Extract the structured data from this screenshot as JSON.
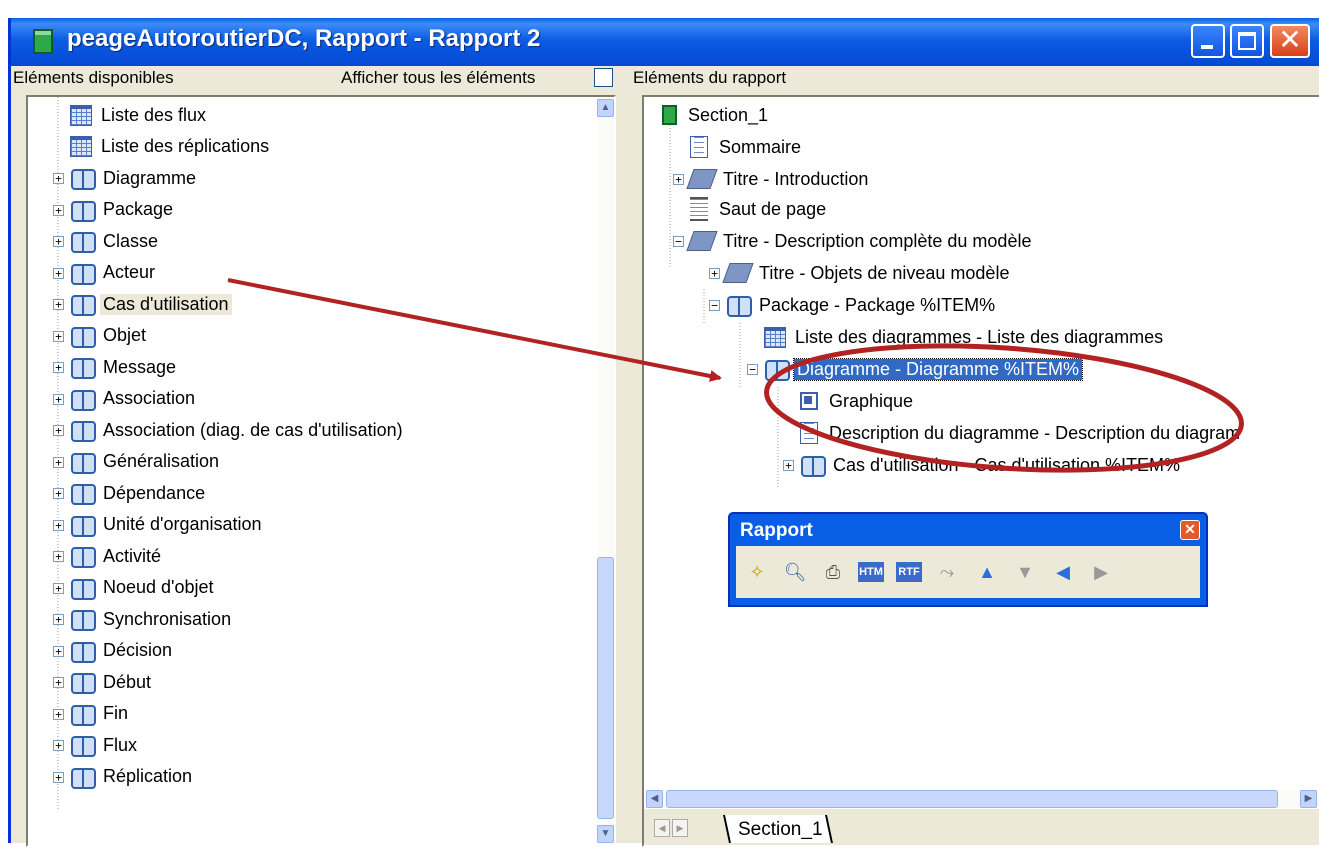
{
  "window": {
    "title": "peageAutoroutierDC, Rapport - Rapport 2",
    "close_glyph": "✕"
  },
  "left": {
    "header": "Eléments disponibles",
    "show_all_label": "Afficher tous les éléments",
    "items": [
      {
        "label": "Liste des flux",
        "icon": "grid-icon"
      },
      {
        "label": "Liste des réplications",
        "icon": "grid-icon"
      },
      {
        "label": "Diagramme",
        "icon": "book-icon"
      },
      {
        "label": "Package",
        "icon": "book-icon"
      },
      {
        "label": "Classe",
        "icon": "book-icon"
      },
      {
        "label": "Acteur",
        "icon": "book-icon"
      },
      {
        "label": "Cas d'utilisation",
        "icon": "book-icon"
      },
      {
        "label": "Objet",
        "icon": "book-icon"
      },
      {
        "label": "Message",
        "icon": "book-icon"
      },
      {
        "label": "Association",
        "icon": "book-icon"
      },
      {
        "label": "Association (diag. de cas d'utilisation)",
        "icon": "book-icon"
      },
      {
        "label": "Généralisation",
        "icon": "book-icon"
      },
      {
        "label": "Dépendance",
        "icon": "book-icon"
      },
      {
        "label": "Unité d'organisation",
        "icon": "book-icon"
      },
      {
        "label": "Activité",
        "icon": "book-icon"
      },
      {
        "label": "Noeud d'objet",
        "icon": "book-icon"
      },
      {
        "label": "Synchronisation",
        "icon": "book-icon"
      },
      {
        "label": "Décision",
        "icon": "book-icon"
      },
      {
        "label": "Début",
        "icon": "book-icon"
      },
      {
        "label": "Fin",
        "icon": "book-icon"
      },
      {
        "label": "Flux",
        "icon": "book-icon"
      },
      {
        "label": "Réplication",
        "icon": "book-icon"
      }
    ]
  },
  "right": {
    "header": "Eléments du rapport",
    "items": [
      {
        "label": "Section_1",
        "icon": "section-icon"
      },
      {
        "label": "Sommaire",
        "icon": "doc-icon"
      },
      {
        "label": "Titre - Introduction",
        "icon": "gem-icon"
      },
      {
        "label": "Saut de page",
        "icon": "page-break-icon"
      },
      {
        "label": "Titre - Description complète du modèle",
        "icon": "gem-icon"
      },
      {
        "label": "Titre - Objets de niveau modèle",
        "icon": "gem-icon"
      },
      {
        "label": "Package - Package %ITEM%",
        "icon": "book-icon"
      },
      {
        "label": "Liste des diagrammes - Liste des diagrammes",
        "icon": "grid-icon"
      },
      {
        "label": "Diagramme - Diagramme %ITEM%",
        "icon": "book-icon"
      },
      {
        "label": "Graphique",
        "icon": "graph-icon"
      },
      {
        "label": "Description du diagramme - Description du diagram",
        "icon": "doc-icon"
      },
      {
        "label": "Cas d'utilisation - Cas d'utilisation %ITEM%",
        "icon": "book-icon"
      }
    ],
    "tab": "Section_1"
  },
  "toolbar": {
    "title": "Rapport",
    "tools": [
      "magic-wand-icon",
      "preview-icon",
      "print-icon",
      "html-icon",
      "rtf-icon",
      "tree-icon",
      "move-up-icon",
      "move-down-icon",
      "move-left-icon",
      "move-right-icon"
    ]
  },
  "colors": {
    "selection": "#316ac5",
    "annotation": "#b22222",
    "titlebar": "#0a5fe8"
  }
}
